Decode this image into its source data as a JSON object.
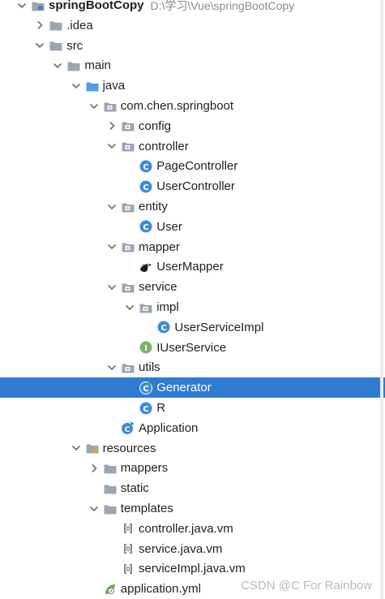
{
  "watermark": "CSDN @C For Rainbow",
  "colors": {
    "selection": "#2f7bd1",
    "folder": "#9ca6b3",
    "java_folder": "#4c9fe5",
    "class_icon": "#3d8bd6",
    "interface_icon": "#78b36b"
  },
  "tree": [
    {
      "label": "springBootCopy",
      "path": "D:\\学习\\Vue\\springBootCopy",
      "depth": 0,
      "arrow": "down",
      "icon": "module-folder-icon",
      "name": "tree-item-springbootcopy",
      "root": true
    },
    {
      "label": ".idea",
      "depth": 1,
      "arrow": "right",
      "icon": "folder-icon",
      "name": "tree-item-idea"
    },
    {
      "label": "src",
      "depth": 1,
      "arrow": "down",
      "icon": "folder-icon",
      "name": "tree-item-src"
    },
    {
      "label": "main",
      "depth": 2,
      "arrow": "down",
      "icon": "folder-icon",
      "name": "tree-item-main"
    },
    {
      "label": "java",
      "depth": 3,
      "arrow": "down",
      "icon": "source-folder-icon",
      "name": "tree-item-java"
    },
    {
      "label": "com.chen.springboot",
      "depth": 4,
      "arrow": "down",
      "icon": "package-icon",
      "name": "tree-item-com-chen-springboot"
    },
    {
      "label": "config",
      "depth": 5,
      "arrow": "right",
      "icon": "package-icon",
      "name": "tree-item-config"
    },
    {
      "label": "controller",
      "depth": 5,
      "arrow": "down",
      "icon": "package-icon",
      "name": "tree-item-controller"
    },
    {
      "label": "PageController",
      "depth": 6,
      "arrow": "none",
      "icon": "class-icon",
      "name": "tree-item-pagecontroller"
    },
    {
      "label": "UserController",
      "depth": 6,
      "arrow": "none",
      "icon": "class-icon",
      "name": "tree-item-usercontroller"
    },
    {
      "label": "entity",
      "depth": 5,
      "arrow": "down",
      "icon": "package-icon",
      "name": "tree-item-entity"
    },
    {
      "label": "User",
      "depth": 6,
      "arrow": "none",
      "icon": "class-icon",
      "name": "tree-item-user"
    },
    {
      "label": "mapper",
      "depth": 5,
      "arrow": "down",
      "icon": "package-icon",
      "name": "tree-item-mapper"
    },
    {
      "label": "UserMapper",
      "depth": 6,
      "arrow": "none",
      "icon": "mybatis-mapper-icon",
      "name": "tree-item-usermapper"
    },
    {
      "label": "service",
      "depth": 5,
      "arrow": "down",
      "icon": "package-icon",
      "name": "tree-item-service"
    },
    {
      "label": "impl",
      "depth": 6,
      "arrow": "down",
      "icon": "package-icon",
      "name": "tree-item-impl"
    },
    {
      "label": "UserServiceImpl",
      "depth": 7,
      "arrow": "none",
      "icon": "class-icon",
      "name": "tree-item-userserviceimpl"
    },
    {
      "label": "IUserService",
      "depth": 6,
      "arrow": "none",
      "icon": "interface-icon",
      "name": "tree-item-iuserservice"
    },
    {
      "label": "utils",
      "depth": 5,
      "arrow": "down",
      "icon": "package-icon",
      "name": "tree-item-utils"
    },
    {
      "label": "Generator",
      "depth": 6,
      "arrow": "none",
      "icon": "runnable-class-icon",
      "name": "tree-item-generator",
      "selected": true
    },
    {
      "label": "R",
      "depth": 6,
      "arrow": "none",
      "icon": "class-icon",
      "name": "tree-item-r"
    },
    {
      "label": "Application",
      "depth": 5,
      "arrow": "none",
      "icon": "spring-boot-app-icon",
      "name": "tree-item-application"
    },
    {
      "label": "resources",
      "depth": 3,
      "arrow": "down",
      "icon": "resources-folder-icon",
      "name": "tree-item-resources"
    },
    {
      "label": "mappers",
      "depth": 4,
      "arrow": "right",
      "icon": "folder-icon",
      "name": "tree-item-mappers"
    },
    {
      "label": "static",
      "depth": 4,
      "arrow": "none",
      "icon": "folder-icon",
      "name": "tree-item-static"
    },
    {
      "label": "templates",
      "depth": 4,
      "arrow": "down",
      "icon": "folder-icon",
      "name": "tree-item-templates"
    },
    {
      "label": "controller.java.vm",
      "depth": 5,
      "arrow": "none",
      "icon": "velocity-file-icon",
      "name": "tree-item-controller-java-vm"
    },
    {
      "label": "service.java.vm",
      "depth": 5,
      "arrow": "none",
      "icon": "velocity-file-icon",
      "name": "tree-item-service-java-vm"
    },
    {
      "label": "serviceImpl.java.vm",
      "depth": 5,
      "arrow": "none",
      "icon": "velocity-file-icon",
      "name": "tree-item-serviceimpl-java-vm"
    },
    {
      "label": "application.yml",
      "depth": 4,
      "arrow": "none",
      "icon": "spring-yaml-icon",
      "name": "tree-item-application-yml"
    }
  ]
}
